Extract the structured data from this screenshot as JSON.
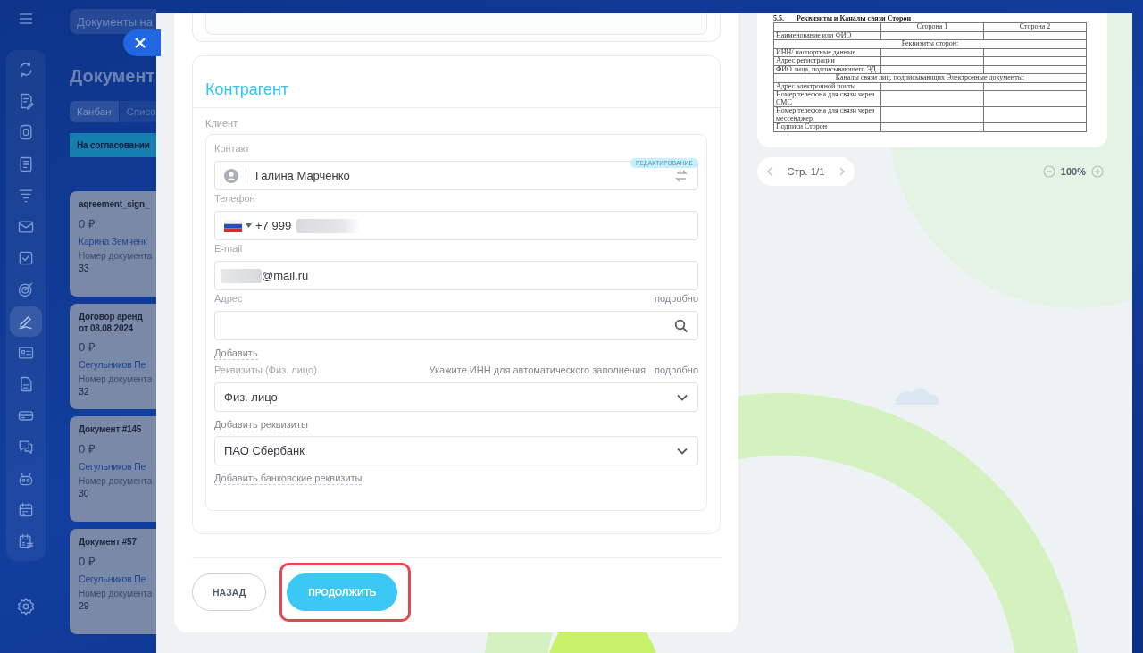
{
  "sidebar": {
    "items": [
      {
        "kind": "sync",
        "selected": false
      },
      {
        "kind": "doc-pen",
        "selected": false
      },
      {
        "kind": "tablet",
        "selected": false
      },
      {
        "kind": "list",
        "selected": false
      },
      {
        "kind": "funnel",
        "selected": false
      },
      {
        "kind": "mail",
        "selected": false
      },
      {
        "kind": "check",
        "selected": false
      },
      {
        "kind": "target",
        "selected": false
      },
      {
        "kind": "sign",
        "selected": true
      },
      {
        "kind": "card",
        "selected": false
      },
      {
        "kind": "doc",
        "selected": false
      },
      {
        "kind": "tray",
        "selected": false
      },
      {
        "kind": "chat",
        "selected": false
      },
      {
        "kind": "robot",
        "selected": false
      },
      {
        "kind": "calendar",
        "selected": false
      },
      {
        "kind": "calendar-list",
        "selected": false
      }
    ]
  },
  "background": {
    "search": {
      "value": "Документы на"
    },
    "title": "Документ",
    "view_tabs": [
      {
        "label": "Канбан",
        "selected": true
      },
      {
        "label": "Списо",
        "selected": false
      }
    ],
    "column": {
      "title": "На согласовании"
    },
    "cards": [
      {
        "title": "aqreement_sign_",
        "amount": "0 ₽",
        "person": "Карина Земченк",
        "field_label": "Номер документа",
        "field_value": "33"
      },
      {
        "title": "Договор аренд\nот 08.08.2024",
        "amount": "0 ₽",
        "person": "Сегульников Пе",
        "field_label": "Номер документа",
        "field_value": "32"
      },
      {
        "title": "Документ #145",
        "amount": "0 ₽",
        "person": "Сегульников Пе",
        "field_label": "Номер документа",
        "field_value": "30"
      },
      {
        "title": "Документ #57",
        "amount": "0 ₽",
        "person": "Сегульников Пе",
        "field_label": "Номер документа",
        "field_value": "29"
      }
    ]
  },
  "form": {
    "section_title": "Контрагент",
    "group_label": "Клиент",
    "fields": [
      {
        "kind": "contact",
        "label": "Контакт",
        "value": "Галина Марченко",
        "badge": "РЕДАКТИРОВАНИЕ"
      },
      {
        "kind": "phone",
        "label": "Телефон",
        "value": "+7 999"
      },
      {
        "kind": "email",
        "label": "E-mail",
        "value": "@mail.ru"
      },
      {
        "kind": "address",
        "label": "Адрес",
        "aside": [
          "подробно"
        ],
        "link": "Добавить"
      },
      {
        "kind": "select",
        "label": "Реквизиты (Физ. лицо)",
        "aside": [
          "Укажите ИНН для автоматического заполнения",
          "подробно"
        ],
        "value": "Физ. лицо",
        "link": "Добавить реквизиты"
      },
      {
        "kind": "select",
        "value": "ПАО Сбербанк",
        "link": "Добавить банковские реквизиты"
      }
    ]
  },
  "buttons": [
    {
      "label": "НАЗАД",
      "kind": "secondary",
      "highlighted": false
    },
    {
      "label": "ПРОДОЛЖИТЬ",
      "kind": "primary",
      "highlighted": true
    }
  ],
  "preview": {
    "heading_number": "5.5.",
    "heading": "Реквизиты и Каналы связи Сторон",
    "columns": [
      "Сторона 1",
      "Сторона 2"
    ],
    "rows": [
      {
        "kind": "row",
        "label": "Наименование или ФИО"
      },
      {
        "kind": "span",
        "label": "Реквизиты сторон:"
      },
      {
        "kind": "row",
        "label": "ИНН/ паспортные данные"
      },
      {
        "kind": "row",
        "label": "Адрес регистрации"
      },
      {
        "kind": "row",
        "label": "ФИО лица, подписывающего ЭД"
      },
      {
        "kind": "span",
        "label": "Каналы связи лиц, подписывающих Электронные документы:"
      },
      {
        "kind": "row",
        "label": "Адрес электронной почты"
      },
      {
        "kind": "row",
        "label": "Номер телефона для связи через СМС"
      },
      {
        "kind": "row",
        "label": "Номер телефона для связи через мессенджер"
      },
      {
        "kind": "row",
        "label": "Подписи Сторон"
      }
    ],
    "pager": "Стр. 1/1",
    "zoom": "100%"
  }
}
